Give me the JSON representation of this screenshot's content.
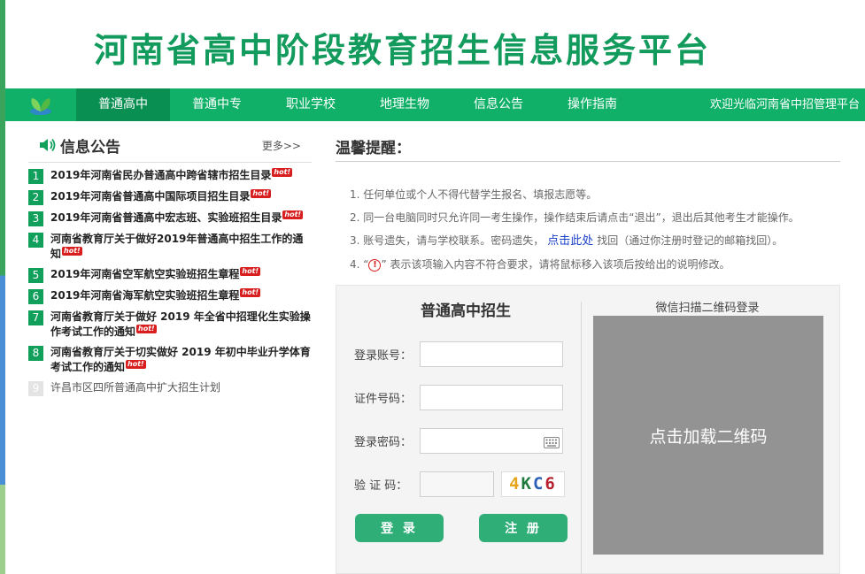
{
  "header": {
    "site_title": "河南省高中阶段教育招生信息服务平台"
  },
  "nav": {
    "items": [
      {
        "label": "普通高中",
        "active": true
      },
      {
        "label": "普通中专",
        "active": false
      },
      {
        "label": "职业学校",
        "active": false
      },
      {
        "label": "地理生物",
        "active": false
      },
      {
        "label": "信息公告",
        "active": false
      },
      {
        "label": "操作指南",
        "active": false
      }
    ],
    "welcome": "欢迎光临河南省中招管理平台"
  },
  "notice": {
    "title": "信息公告",
    "more": "更多>>",
    "hot_badge": "hot!",
    "items": [
      {
        "num": "1",
        "text": "2019年河南省民办普通高中跨省辖市招生目录",
        "hot": true
      },
      {
        "num": "2",
        "text": "2019年河南省普通高中国际项目招生目录",
        "hot": true
      },
      {
        "num": "3",
        "text": "2019年河南省普通高中宏志班、实验班招生目录",
        "hot": true
      },
      {
        "num": "4",
        "text": "河南省教育厅关于做好2019年普通高中招生工作的通知",
        "hot": true
      },
      {
        "num": "5",
        "text": "2019年河南省空军航空实验班招生章程",
        "hot": true
      },
      {
        "num": "6",
        "text": "2019年河南省海军航空实验班招生章程",
        "hot": true
      },
      {
        "num": "7",
        "text": "河南省教育厅关于做好 2019 年全省中招理化生实验操作考试工作的通知",
        "hot": true
      },
      {
        "num": "8",
        "text": "河南省教育厅关于切实做好 2019 年初中毕业升学体育考试工作的通知",
        "hot": true
      },
      {
        "num": "9",
        "text": "许昌市区四所普通高中扩大招生计划",
        "hot": false
      }
    ]
  },
  "tips": {
    "title": "温馨提醒：",
    "line1": "1. 任何单位或个人不得代替学生报名、填报志愿等。",
    "line2": "2. 同一台电脑同时只允许同一考生操作，操作结束后请点击“退出”，退出后其他考生才能操作。",
    "line3_prefix": "3. 账号遗失，请与学校联系。密码遗失，",
    "line3_link": "点击此处",
    "line3_suffix": "找回（通过你注册时登记的邮箱找回）。",
    "line4_prefix": "4. “",
    "line4_icon": "!",
    "line4_suffix": "” 表示该项输入内容不符合要求，请将鼠标移入该项后按给出的说明修改。"
  },
  "login": {
    "form_title": "普通高中招生",
    "account_label": "登录账号：",
    "account_value": "",
    "id_label": "证件号码：",
    "id_value": "",
    "password_label": "登录密码：",
    "password_value": "",
    "captcha_label": "验 证 码：",
    "captcha_value": "",
    "captcha_text": "4KC6",
    "login_button": "登 录",
    "register_button": "注 册",
    "qr_title": "微信扫描二维码登录",
    "qr_load": "点击加载二维码"
  },
  "colors": {
    "brand_green": "#10b069",
    "title_green": "#129b5c",
    "button_green": "#2fae78",
    "hot_red": "#d81e1e"
  }
}
